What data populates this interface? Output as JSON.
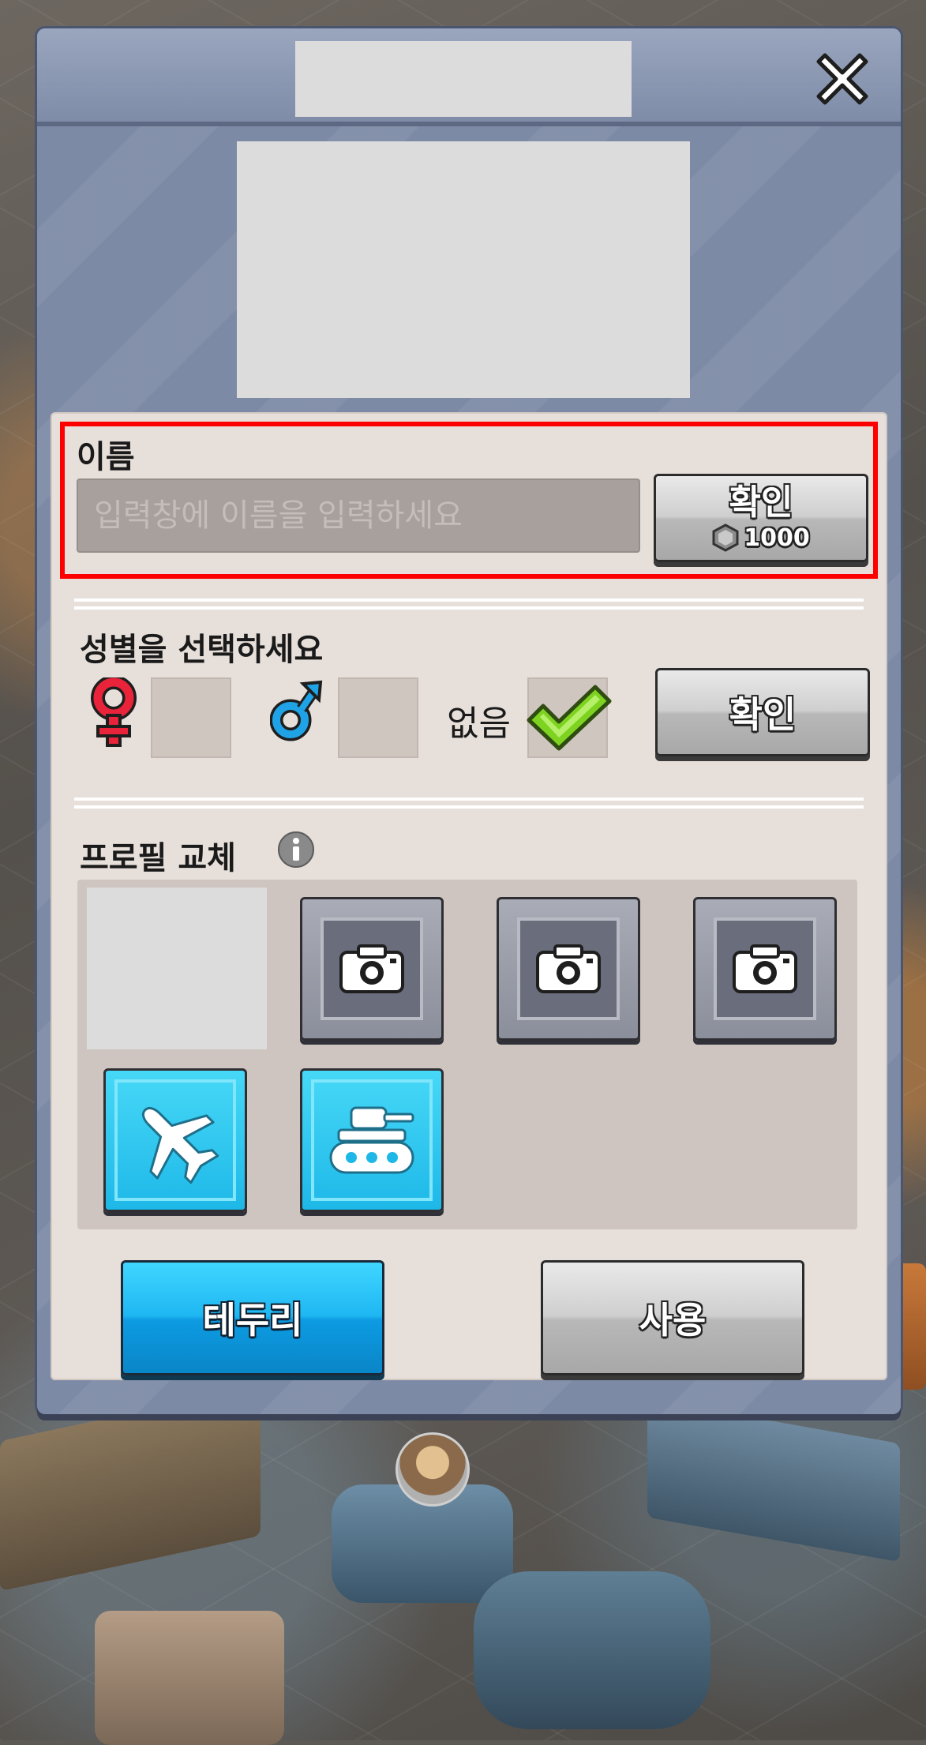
{
  "name_section": {
    "label": "이름",
    "input_placeholder": "입력창에 이름을 입력하세요",
    "confirm_label": "확인",
    "cost": "1000"
  },
  "gender_section": {
    "label": "성별을 선택하세요",
    "none_label": "없음",
    "selected": "none",
    "confirm_label": "확인"
  },
  "profile_section": {
    "label": "프로필 교체",
    "slots": [
      "camera-icon",
      "camera-icon",
      "camera-icon",
      "airplane-icon",
      "tank-icon"
    ]
  },
  "footer": {
    "frame_label": "테두리",
    "use_label": "사용"
  },
  "colors": {
    "highlight": "#ff0000",
    "female": "#e8233a",
    "male": "#1fa3e6",
    "check": "#7ed321",
    "blue_button": "#1fb7f2"
  }
}
